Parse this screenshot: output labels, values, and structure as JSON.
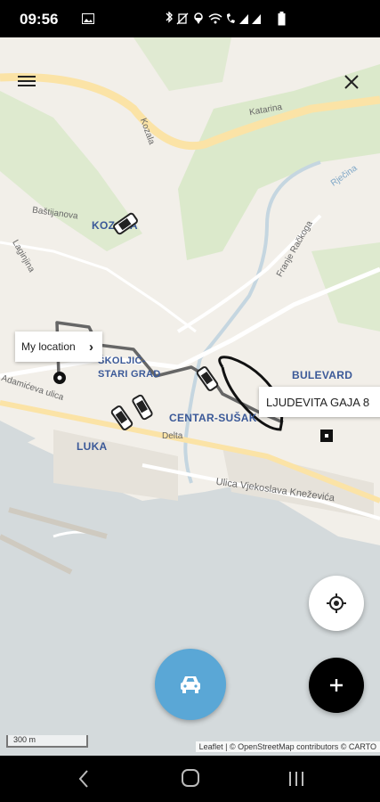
{
  "status_bar": {
    "time": "09:56"
  },
  "map": {
    "districts": [
      "KOZALA",
      "ŠKOLJIĆ-STARI GRAD",
      "BULEVARD",
      "CENTAR-SUŠAK",
      "LUKA"
    ],
    "streets": [
      "Katarina",
      "Kozala",
      "Baštijanova",
      "Laginjina",
      "Adamićeva ulica",
      "Franje Račkoga",
      "Rječina",
      "Delta",
      "Ulica Vjekoslava Kneževića"
    ],
    "current_location_label": "My location",
    "destination_label": "LJUDEVITA GAJA 8",
    "scale": "300 m",
    "attribution": "Leaflet | © OpenStreetMap contributors © CARTO",
    "colors": {
      "water": "#d4dadc",
      "park": "#d8e8c8",
      "road_major": "#fbe3a6",
      "taxi_button": "#5aa7d6"
    }
  },
  "buttons": {
    "menu": "menu-icon",
    "close": "close-icon",
    "locate": "crosshair-icon",
    "taxi": "taxi-icon",
    "add": "plus-icon"
  },
  "nav": {
    "back": "back-icon",
    "home": "home-icon",
    "recents": "recents-icon"
  }
}
